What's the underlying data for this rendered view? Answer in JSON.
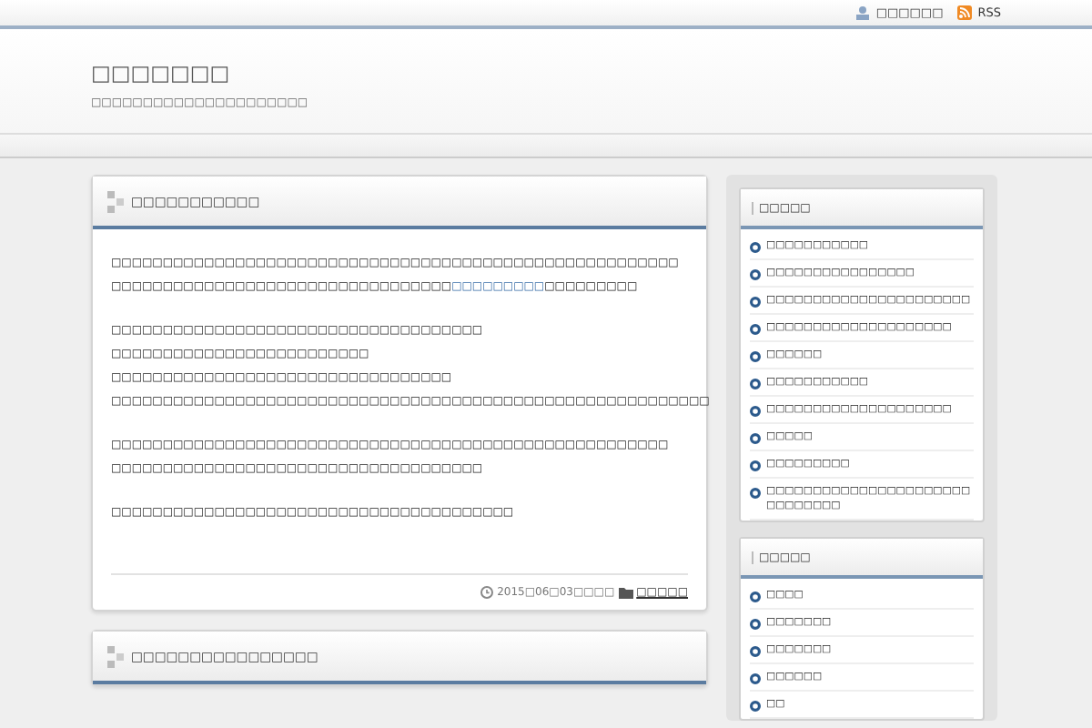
{
  "top_links": [
    {
      "kind": "user",
      "label": "□□□□□□"
    },
    {
      "kind": "rss",
      "label": "RSS"
    }
  ],
  "site": {
    "title": "□□□□□□□",
    "tagline": "□□□□□□□□□□□□□□□□□□□□□"
  },
  "posts": [
    {
      "title": "□□□□□□□□□□□",
      "paragraphs": [
        [
          [
            {
              "text": "□□□□□□□□□□□□□□□□□□□□□□□□□□□□□□□□□□□□□□□□□□□□□□□□□□□□□□□"
            }
          ],
          [
            {
              "text": "□□□□□□□□□□□□□□□□□□□□□□□□□□□□□□□□□"
            },
            {
              "text": "□□□□□□□□□",
              "link": true
            },
            {
              "text": "□□□□□□□□□"
            }
          ]
        ],
        [
          [
            {
              "text": "□□□□□□□□□□□□□□□□□□□□□□□□□□□□□□□□□□□□"
            }
          ],
          [
            {
              "text": "□□□□□□□□□□□□□□□□□□□□□□□□□"
            }
          ],
          [
            {
              "text": "□□□□□□□□□□□□□□□□□□□□□□□□□□□□□□□□□"
            }
          ],
          [
            {
              "text": "□□□□□□□□□□□□□□□□□□□□□□□□□□□□□□□□□□□□□□□□□□□□□□□□□□□□□□□□□□"
            }
          ]
        ],
        [
          [
            {
              "text": "□□□□□□□□□□□□□□□□□□□□□□□□□□□□□□□□□□□□□□□□□□□□□□□□□□□□□□"
            }
          ],
          [
            {
              "text": "□□□□□□□□□□□□□□□□□□□□□□□□□□□□□□□□□□□□"
            }
          ]
        ],
        [
          [
            {
              "text": "□□□□□□□□□□□□□□□□□□□□□□□□□□□□□□□□□□□□□□□"
            }
          ]
        ]
      ],
      "date": "2015□06□03□□□□",
      "category": "□□□□□"
    },
    {
      "title": "□□□□□□□□□□□□□□□□"
    }
  ],
  "widgets": [
    {
      "title": "□□□□□",
      "items": [
        "□□□□□□□□□□□",
        "□□□□□□□□□□□□□□□□",
        "□□□□□□□□□□□□□□□□□□□□□□",
        "□□□□□□□□□□□□□□□□□□□□",
        "□□□□□□",
        "□□□□□□□□□□□",
        "□□□□□□□□□□□□□□□□□□□□",
        "□□□□□",
        "□□□□□□□□□",
        "□□□□□□□□□□□□□□□□□□□□□□□□□□□□□□"
      ]
    },
    {
      "title": "□□□□□",
      "items": [
        "□□□□",
        "□□□□□□□",
        "□□□□□□□",
        "□□□□□□",
        "□□"
      ]
    }
  ]
}
